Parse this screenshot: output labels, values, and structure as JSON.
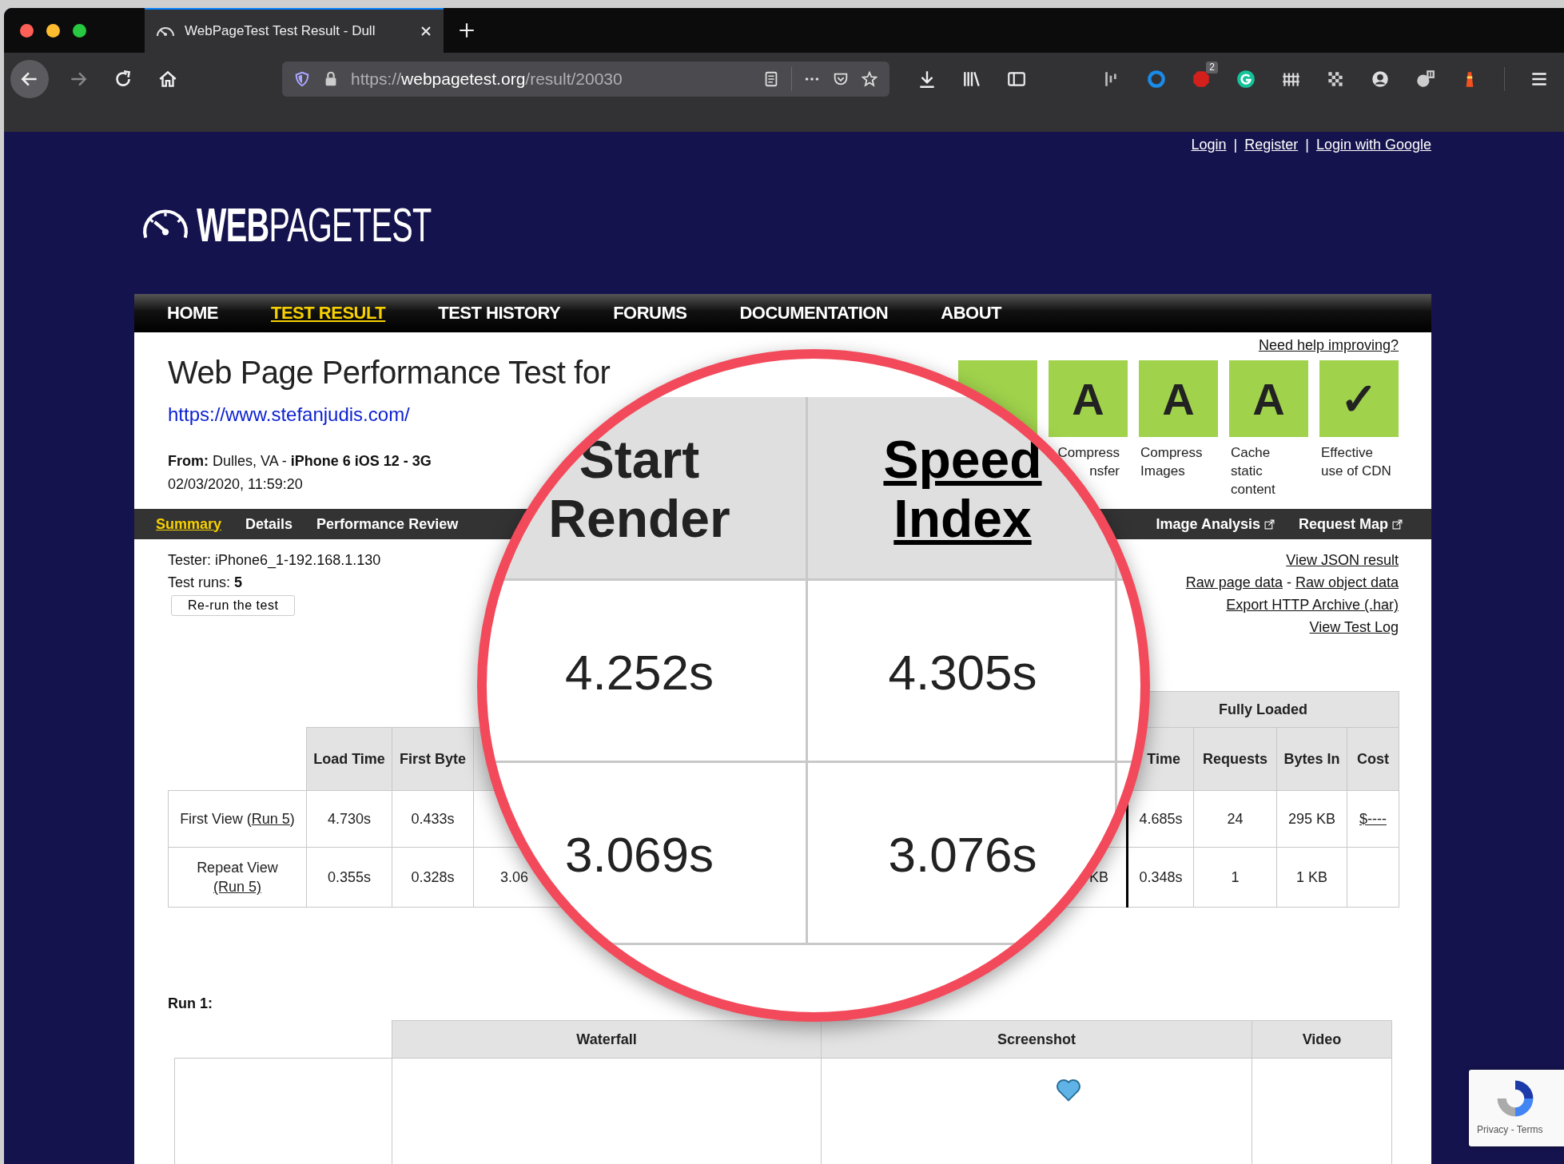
{
  "browser": {
    "tab_title": "WebPageTest Test Result - Dull",
    "url": {
      "scheme": "https://",
      "host": "webpagetest.org",
      "path": "/result/20030"
    },
    "extension_badge": "2"
  },
  "account_links": {
    "items": [
      "Login",
      "Register",
      "Login with Google"
    ],
    "separator": "|"
  },
  "logo": {
    "text": "**WEB**PAGETEST"
  },
  "nav": {
    "items": [
      {
        "label": "HOME",
        "selected": false
      },
      {
        "label": "TEST RESULT",
        "selected": true
      },
      {
        "label": "TEST HISTORY",
        "selected": false
      },
      {
        "label": "FORUMS",
        "selected": false
      },
      {
        "label": "DOCUMENTATION",
        "selected": false
      },
      {
        "label": "ABOUT",
        "selected": false
      }
    ]
  },
  "header": {
    "title": "Web Page Performance Test for",
    "url": "https://www.stefanjudis.com/",
    "from": "**From:** Dulles, VA - **iPhone 6 iOS 12 - 3G**",
    "date": "02/03/2020, 11:59:20",
    "help_link": "Need help improving?"
  },
  "grades": [
    {
      "kind": "blank"
    },
    {
      "kind": "letter",
      "grade": "A",
      "label": [
        "Compress",
        "nsfer"
      ]
    },
    {
      "kind": "letter",
      "grade": "A",
      "label": [
        "Compress",
        "Images"
      ]
    },
    {
      "kind": "letter",
      "grade": "A",
      "label": [
        "Cache",
        "static",
        "content"
      ]
    },
    {
      "kind": "letter",
      "grade": "✓",
      "label": [
        "Effective",
        "use of CDN"
      ]
    }
  ],
  "subnav": {
    "left_items": [
      {
        "label": "Summary",
        "selected": true,
        "external": false
      },
      {
        "label": "Details",
        "selected": false,
        "external": false
      },
      {
        "label": "Performance Review",
        "selected": false,
        "external": false
      }
    ],
    "right_items": [
      {
        "label": "Image Analysis",
        "selected": false,
        "external": true
      },
      {
        "label": "Request Map",
        "selected": false,
        "external": true
      }
    ]
  },
  "test_info": {
    "tester": "Tester: iPhone6_1-192.168.1.130",
    "runs": "Test runs: **5**",
    "rerun_button": "Re-run the test"
  },
  "result_links": {
    "separator": "-",
    "lines": [
      [
        "View JSON result"
      ],
      [
        "Raw page data",
        "Raw object data"
      ],
      [
        "Export HTTP Archive (.har)"
      ],
      [
        "View Test Log"
      ]
    ]
  },
  "summary_table": {
    "group_header": "Fully Loaded",
    "columns": [
      "Load Time",
      "First Byte",
      null,
      null,
      "Time",
      "Requests",
      "Bytes In",
      "Cost"
    ],
    "rows": [
      {
        "label": "First View (",
        "run_link": "Run 5",
        "label_end": ")",
        "cells": [
          "4.730s",
          "0.433s",
          null,
          null,
          "4.685s",
          "24",
          "295 KB",
          {
            "text": "$----",
            "link": true
          }
        ]
      },
      {
        "label": "Repeat View",
        "run_link": "(Run 5)",
        "cells": [
          "0.355s",
          "0.328s",
          "3.06",
          "KB",
          "0.348s",
          "1",
          "1 KB",
          null
        ]
      }
    ]
  },
  "magnifier": {
    "columns": [
      {
        "label": "Start Render",
        "link": false
      },
      {
        "label": "Speed Index",
        "link": true
      }
    ],
    "rows": [
      [
        "4.252s",
        "4.305s"
      ],
      [
        "3.069s",
        "3.076s"
      ]
    ]
  },
  "run": {
    "title": "Run 1:",
    "columns": [
      "Waterfall",
      "Screenshot",
      "Video"
    ]
  },
  "recaptcha": {
    "links": "Privacy - Terms"
  }
}
